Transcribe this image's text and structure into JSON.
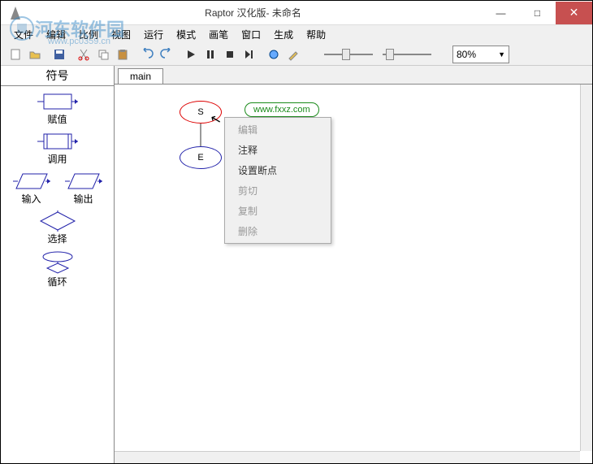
{
  "titlebar": {
    "title": "Raptor 汉化版- 未命名"
  },
  "menu": {
    "file": "文件",
    "edit": "编辑",
    "scale": "比例",
    "view": "视图",
    "run": "运行",
    "mode": "模式",
    "pen": "画笔",
    "window": "窗口",
    "generate": "生成",
    "help": "帮助"
  },
  "zoom": {
    "value": "80%"
  },
  "sidebar": {
    "title": "符号",
    "assign": "赋值",
    "call": "调用",
    "input": "输入",
    "output": "输出",
    "select": "选择",
    "loop": "循环"
  },
  "tabs": {
    "main": "main"
  },
  "nodes": {
    "start": "S",
    "end": "E"
  },
  "watermark_link": "www.fxxz.com",
  "context_menu": {
    "edit": "编辑",
    "comment": "注释",
    "breakpoint": "设置断点",
    "cut": "剪切",
    "copy": "复制",
    "delete": "删除"
  },
  "watermark": {
    "text": "河东软件园",
    "url": "www.pc0359.cn"
  }
}
